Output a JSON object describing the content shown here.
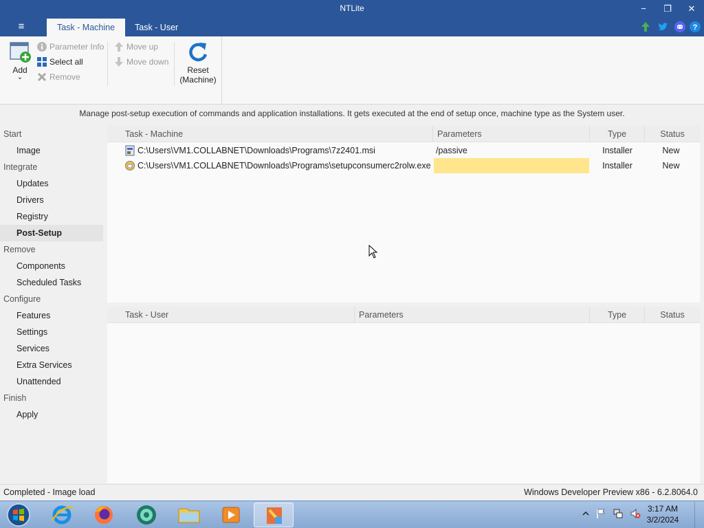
{
  "window": {
    "title": "NTLite",
    "minimize_glyph": "−",
    "maximize_glyph": "❐",
    "close_glyph": "✕"
  },
  "ribbon_tabs": [
    {
      "label": "Task - Machine",
      "active": true
    },
    {
      "label": "Task - User",
      "active": false
    }
  ],
  "hamburger_glyph": "≡",
  "social_icons": [
    "update-arrow-icon",
    "twitter-icon",
    "discord-icon",
    "help-icon"
  ],
  "ribbon": {
    "add": {
      "label": "Add",
      "arrow": "⌄",
      "icon": "add-task-icon"
    },
    "parameter_info": {
      "label": "Parameter Info",
      "enabled": false,
      "icon": "info-icon"
    },
    "select_all": {
      "label": "Select all",
      "enabled": true,
      "icon": "select-all-icon"
    },
    "remove": {
      "label": "Remove",
      "enabled": false,
      "icon": "remove-x-icon"
    },
    "move_up": {
      "label": "Move up",
      "enabled": false,
      "icon": "arrow-up-icon"
    },
    "move_down": {
      "label": "Move down",
      "enabled": false,
      "icon": "arrow-down-icon"
    },
    "reset": {
      "label_line1": "Reset",
      "label_line2": "(Machine)",
      "icon": "reset-refresh-icon"
    }
  },
  "description": "Manage post-setup execution of commands and application installations. It gets executed at the end of setup once, machine type as the System user.",
  "sidebar": {
    "groups": [
      {
        "category": "Start",
        "items": [
          {
            "label": "Image",
            "active": false
          }
        ]
      },
      {
        "category": "Integrate",
        "items": [
          {
            "label": "Updates",
            "active": false
          },
          {
            "label": "Drivers",
            "active": false
          },
          {
            "label": "Registry",
            "active": false
          },
          {
            "label": "Post-Setup",
            "active": true
          }
        ]
      },
      {
        "category": "Remove",
        "items": [
          {
            "label": "Components",
            "active": false
          },
          {
            "label": "Scheduled Tasks",
            "active": false
          }
        ]
      },
      {
        "category": "Configure",
        "items": [
          {
            "label": "Features",
            "active": false
          },
          {
            "label": "Settings",
            "active": false
          },
          {
            "label": "Services",
            "active": false
          },
          {
            "label": "Extra Services",
            "active": false
          },
          {
            "label": "Unattended",
            "active": false
          }
        ]
      },
      {
        "category": "Finish",
        "items": [
          {
            "label": "Apply",
            "active": false
          }
        ]
      }
    ]
  },
  "machine_grid": {
    "columns": [
      "Task - Machine",
      "Parameters",
      "Type",
      "Status"
    ],
    "rows": [
      {
        "icon": "msi-installer-icon",
        "task": "C:\\Users\\VM1.COLLABNET\\Downloads\\Programs\\7z2401.msi",
        "parameters": "/passive",
        "type": "Installer",
        "status": "New",
        "param_highlight": false
      },
      {
        "icon": "exe-installer-icon",
        "task": "C:\\Users\\VM1.COLLABNET\\Downloads\\Programs\\setupconsumerc2rolw.exe",
        "parameters": "",
        "type": "Installer",
        "status": "New",
        "param_highlight": true
      }
    ]
  },
  "user_grid": {
    "columns": [
      "Task - User",
      "Parameters",
      "Type",
      "Status"
    ],
    "rows": []
  },
  "statusbar": {
    "left": "Completed - Image load",
    "right": "Windows Developer Preview x86 - 6.2.8064.0"
  },
  "taskbar": {
    "start_icon": "windows-start-orb-icon",
    "apps": [
      "internet-explorer-icon",
      "firefox-icon",
      "chat-app-icon",
      "file-explorer-icon",
      "media-player-icon",
      "ntlite-icon"
    ],
    "active_app": 5,
    "tray_icons": [
      "show-hidden-icons-arrow-icon",
      "action-center-flag-icon",
      "network-icon",
      "volume-muted-icon"
    ],
    "time": "3:17 AM",
    "date": "3/2/2024"
  },
  "colors": {
    "accent": "#2b579a",
    "param_highlight": "#ffe68c",
    "sidebar_active": "#e4e4e4"
  }
}
